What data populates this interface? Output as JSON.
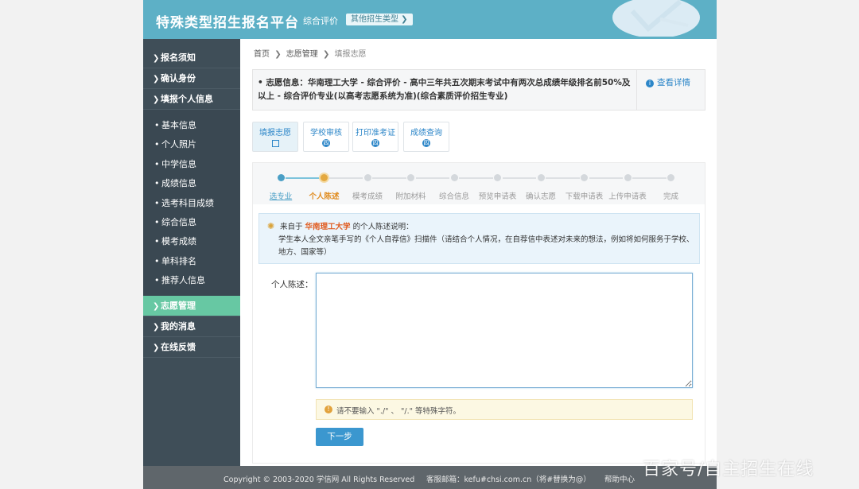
{
  "header": {
    "title": "特殊类型招生报名平台",
    "subtitle": "综合评价",
    "other_type_button": "其他招生类型 ❯"
  },
  "sidebar": {
    "top_items": [
      {
        "label": "报名须知"
      },
      {
        "label": "确认身份"
      },
      {
        "label": "填报个人信息"
      }
    ],
    "sub_items": [
      {
        "label": "基本信息"
      },
      {
        "label": "个人照片"
      },
      {
        "label": "中学信息"
      },
      {
        "label": "成绩信息"
      },
      {
        "label": "选考科目成绩"
      },
      {
        "label": "综合信息"
      },
      {
        "label": "模考成绩"
      },
      {
        "label": "单科排名"
      },
      {
        "label": "推荐人信息"
      }
    ],
    "bottom_items": [
      {
        "label": "志愿管理",
        "active": true
      },
      {
        "label": "我的消息"
      },
      {
        "label": "在线反馈"
      }
    ]
  },
  "breadcrumb": {
    "home": "首页",
    "level2": "志愿管理",
    "current": "填报志愿",
    "separator": "❯"
  },
  "notice": {
    "bullet": "•",
    "text": "志愿信息：华南理工大学 - 综合评价 - 高中三年共五次期末考试中有两次总成绩年级排名前50%及以上 - 综合评价专业(以高考志愿系统为准)(综合素质评价招生专业)",
    "detail_link": "查看详情"
  },
  "tabs": [
    {
      "label": "填报志愿",
      "active": true
    },
    {
      "label": "学校审核",
      "badge": "四"
    },
    {
      "label": "打印准考证",
      "badge": "四"
    },
    {
      "label": "成绩查询",
      "badge": "四"
    }
  ],
  "steps": [
    {
      "label": "选专业",
      "state": "done"
    },
    {
      "label": "个人陈述",
      "state": "current"
    },
    {
      "label": "模考成绩",
      "state": "todo"
    },
    {
      "label": "附加材料",
      "state": "todo"
    },
    {
      "label": "综合信息",
      "state": "todo"
    },
    {
      "label": "预览申请表",
      "state": "todo"
    },
    {
      "label": "确认志愿",
      "state": "todo"
    },
    {
      "label": "下载申请表",
      "state": "todo"
    },
    {
      "label": "上传申请表",
      "state": "todo"
    },
    {
      "label": "完成",
      "state": "todo"
    }
  ],
  "hint": {
    "prefix": "来自于",
    "university": "华南理工大学",
    "suffix": "的个人陈述说明：",
    "body": "学生本人全文亲笔手写的《个人自荐信》扫描件（请结合个人情况，在自荐信中表述对未来的想法，例如将如何服务于学校、地方、国家等）"
  },
  "form": {
    "label": "个人陈述：",
    "value": "",
    "warning": "请不要输入 \"./\" 、 \"/.\" 等特殊字符。",
    "next_button": "下一步"
  },
  "footer": {
    "copyright": "Copyright © 2003-2020 学信网 All Rights Reserved",
    "email": "客服邮箱：kefu#chsi.com.cn（将#替换为@）",
    "help": "帮助中心"
  },
  "watermark": "百家号/自主招生在线",
  "colors": {
    "header": "#5db0c6",
    "sidebar": "#3f4e58",
    "sidebar_active": "#67c8a3",
    "link": "#2c86c8",
    "step_current": "#e08a1b",
    "highlight": "#e05a1e",
    "button": "#3b97cf"
  }
}
